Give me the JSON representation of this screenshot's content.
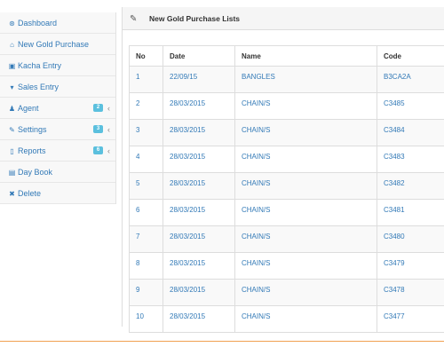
{
  "sidebar": {
    "items": [
      {
        "label": "Dashboard",
        "icon": "dashboard-icon",
        "glyph": "⊛"
      },
      {
        "label": "New Gold Purchase",
        "icon": "home-icon",
        "glyph": "⌂"
      },
      {
        "label": "Kacha Entry",
        "icon": "hdd-icon",
        "glyph": "▣"
      },
      {
        "label": "Sales Entry",
        "icon": "cart-icon",
        "glyph": "▾"
      },
      {
        "label": "Agent",
        "icon": "user-icon",
        "glyph": "♟",
        "badge": "2"
      },
      {
        "label": "Settings",
        "icon": "wrench-icon",
        "glyph": "✎",
        "badge": "3"
      },
      {
        "label": "Reports",
        "icon": "file-icon",
        "glyph": "▯",
        "badge": "6"
      },
      {
        "label": "Day Book",
        "icon": "table-icon",
        "glyph": "▤"
      },
      {
        "label": "Delete",
        "icon": "times-icon",
        "glyph": "✖"
      }
    ]
  },
  "panel": {
    "title": "New Gold Purchase Lists",
    "edit_icon": "edit-icon"
  },
  "table": {
    "headers": [
      "No",
      "Date",
      "Name",
      "Code"
    ],
    "rows": [
      [
        "1",
        "22/09/15",
        "BANGLES",
        "B3CA2A"
      ],
      [
        "2",
        "28/03/2015",
        "CHAIN/S",
        "C3485"
      ],
      [
        "3",
        "28/03/2015",
        "CHAIN/S",
        "C3484"
      ],
      [
        "4",
        "28/03/2015",
        "CHAIN/S",
        "C3483"
      ],
      [
        "5",
        "28/03/2015",
        "CHAIN/S",
        "C3482"
      ],
      [
        "6",
        "28/03/2015",
        "CHAIN/S",
        "C3481"
      ],
      [
        "7",
        "28/03/2015",
        "CHAIN/S",
        "C3480"
      ],
      [
        "8",
        "28/03/2015",
        "CHAIN/S",
        "C3479"
      ],
      [
        "9",
        "28/03/2015",
        "CHAIN/S",
        "C3478"
      ],
      [
        "10",
        "28/03/2015",
        "CHAIN/S",
        "C3477"
      ]
    ]
  },
  "colors": {
    "link": "#337ab7",
    "badge": "#5bc0de",
    "footer_accent": "#f0a050"
  }
}
